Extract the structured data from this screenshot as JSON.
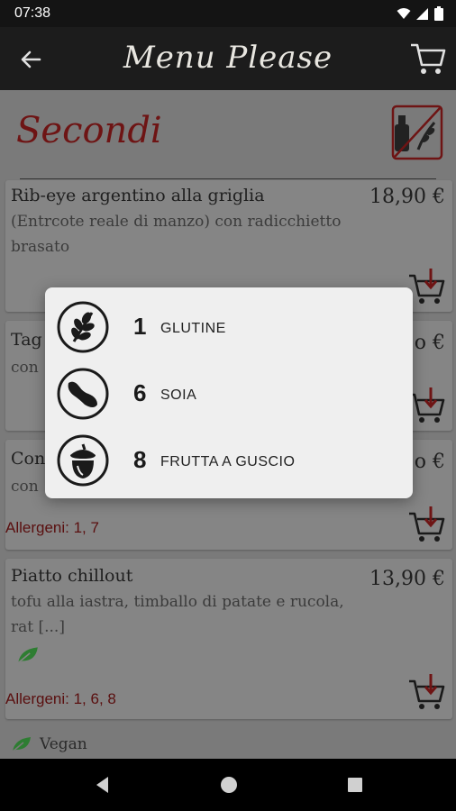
{
  "status": {
    "time": "07:38"
  },
  "app": {
    "title": "Menu Please"
  },
  "section": {
    "title": "Secondi"
  },
  "items": [
    {
      "name": "Rib-eye argentino alla griglia",
      "price": "18,90 €",
      "description": "(Entrcote reale di manzo) con radicchietto brasato"
    },
    {
      "name": "Tag",
      "price": "o €",
      "description": "con"
    },
    {
      "name": "Con",
      "price": "o €",
      "description": "con",
      "allergens": "Allergeni: 1, 7"
    },
    {
      "name": "Piatto chillout",
      "price": "13,90 €",
      "description": "tofu alla iastra, timballo di patate e rucola, rat [...]",
      "allergens": "Allergeni: 1, 6, 8"
    }
  ],
  "footer": {
    "vegan_label": "Vegan"
  },
  "dialog": {
    "allergens": [
      {
        "number": "1",
        "name": "GLUTINE",
        "icon": "wheat-icon"
      },
      {
        "number": "6",
        "name": "SOIA",
        "icon": "soy-icon"
      },
      {
        "number": "8",
        "name": "FRUTTA A GUSCIO",
        "icon": "nut-icon"
      }
    ]
  },
  "colors": {
    "accent": "#6e1414",
    "allergen_text": "#5a0f0f",
    "vegan_green": "#2e7d32"
  }
}
